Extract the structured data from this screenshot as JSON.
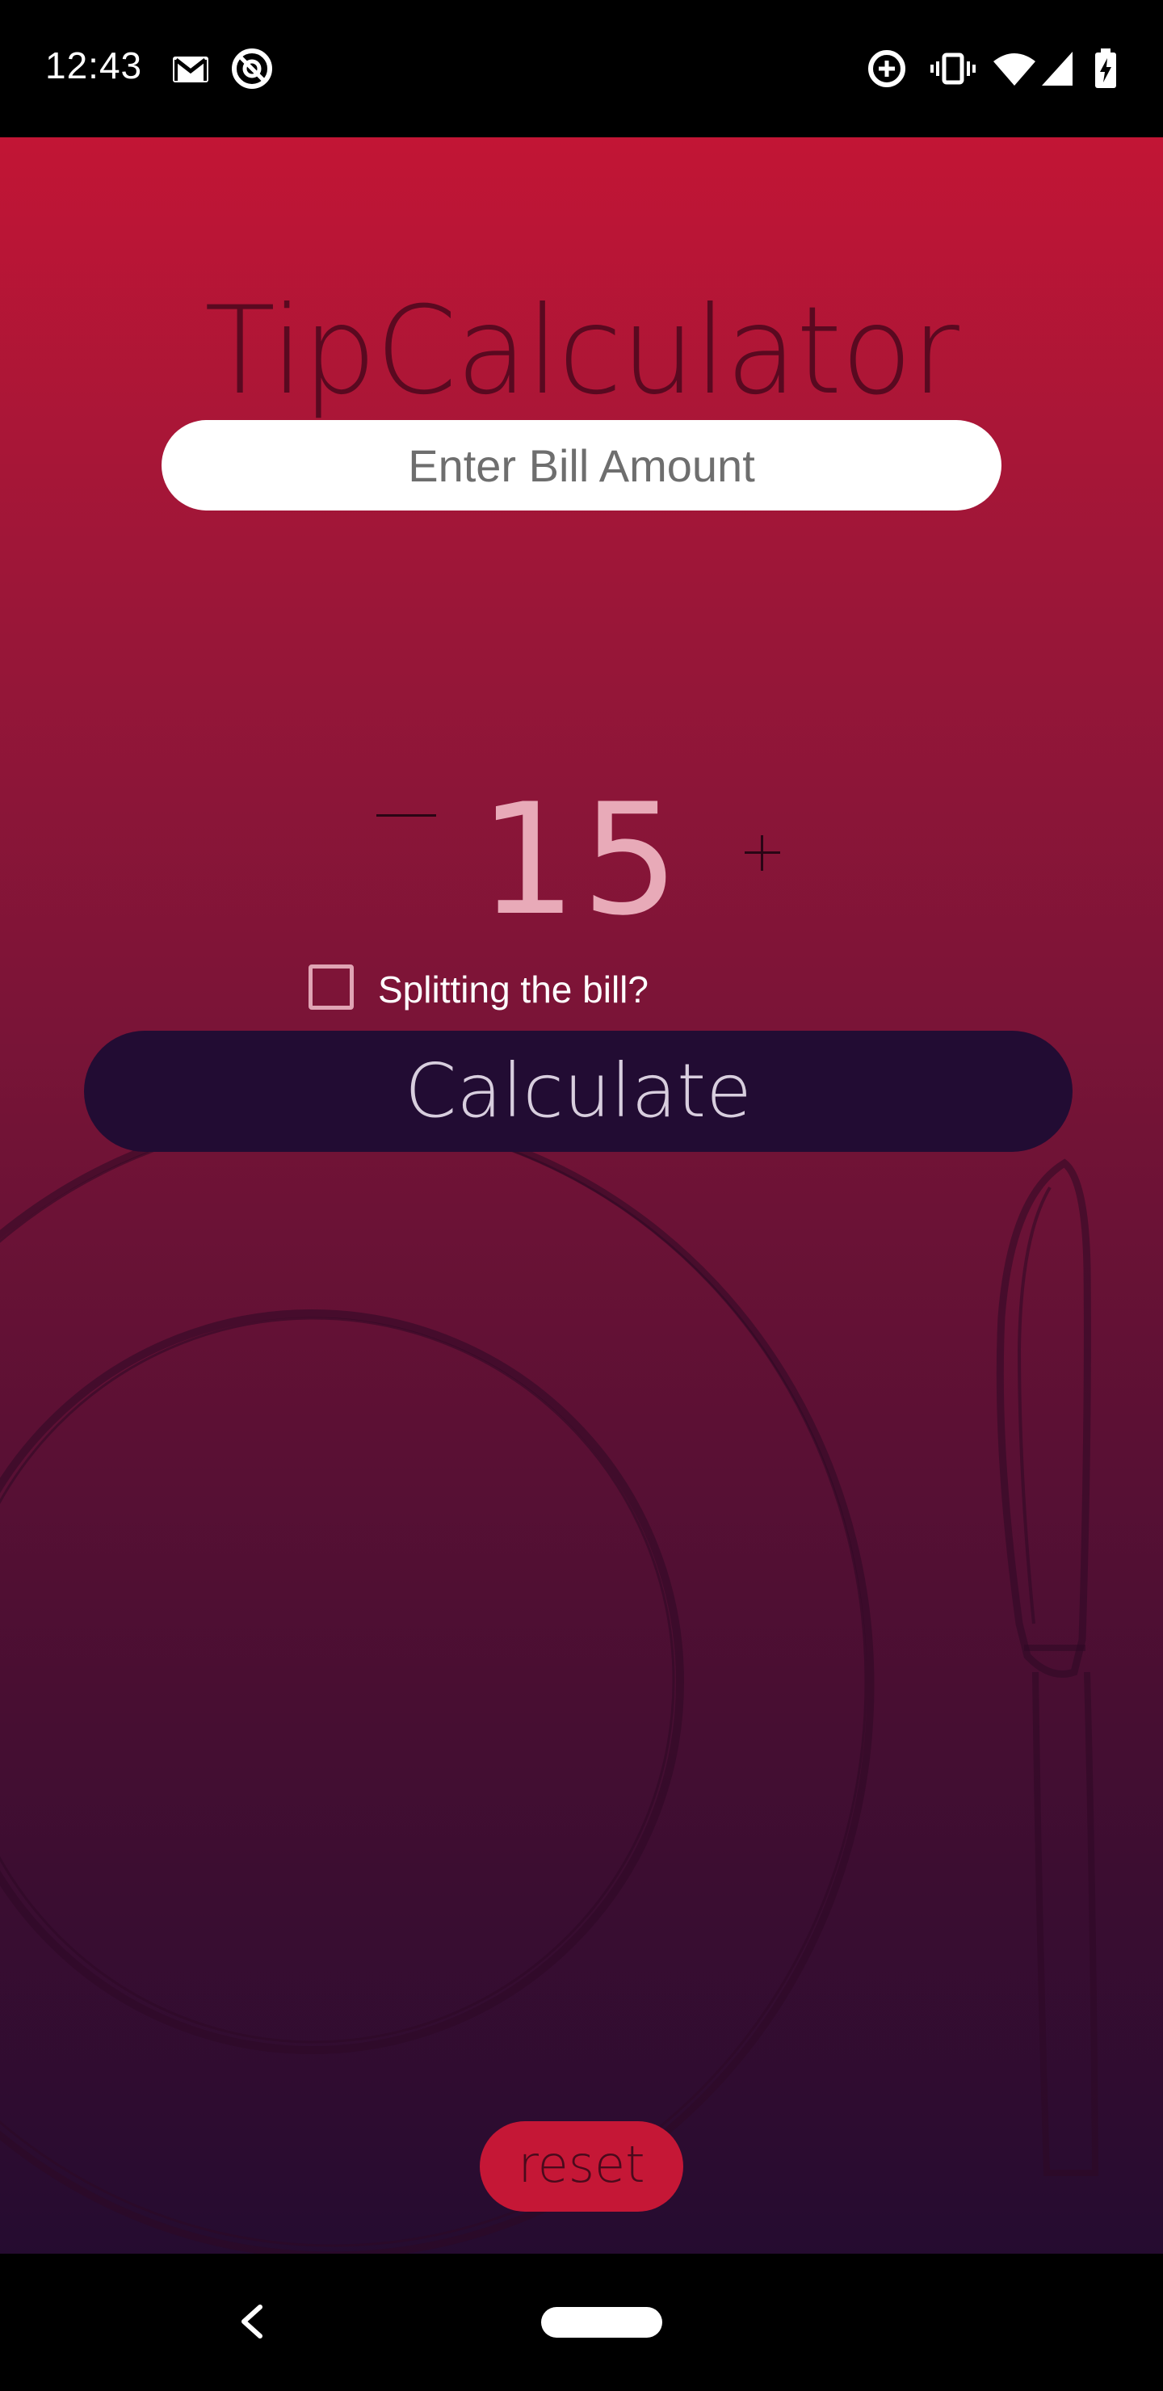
{
  "status_bar": {
    "time": "12:43",
    "left_icons": [
      "gmail-icon",
      "do-not-disturb-icon"
    ],
    "right_icons": [
      "data-saver-icon",
      "vibrate-icon",
      "wifi-icon",
      "cellular-signal-icon",
      "battery-charging-icon"
    ]
  },
  "app": {
    "title": "TipCalculator",
    "bill_input": {
      "placeholder": "Enter Bill Amount",
      "value": ""
    },
    "tip": {
      "value": "15",
      "decrease_label": "—",
      "increase_label": "+"
    },
    "split": {
      "label": "Splitting the bill?",
      "checked": false
    },
    "calculate_label": "Calculate",
    "reset_label": "reset"
  },
  "colors": {
    "gradient_top": "#c21535",
    "gradient_bottom": "#250c30",
    "calculate_bg": "#220c33",
    "reset_bg": "#c51736"
  },
  "nav_bar": {
    "buttons": [
      "back-icon",
      "home-pill-icon"
    ]
  }
}
